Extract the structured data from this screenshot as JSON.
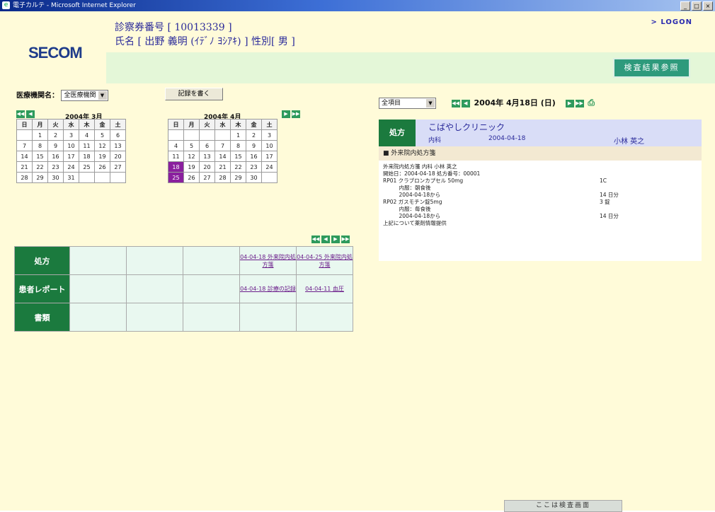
{
  "window": {
    "title": "電子カルテ - Microsoft Internet Explorer",
    "buttons": [
      "_",
      "□",
      "×"
    ]
  },
  "header": {
    "logo": "SECOM",
    "card_no_line": "診察券番号 [ 10013339 ]",
    "name_line": "氏名 [ 出野 義明 (ｲﾃﾞﾉ ﾖｼｱｷ) ] 性別[ 男 ]",
    "logon": "> LOGON",
    "menu_button": "検査結果参照"
  },
  "left": {
    "facility_label": "医療機関名：",
    "facility_value": "全医療機関",
    "record_button": "記録を書く",
    "nav_prev2": "◀◀",
    "nav_prev": "◀",
    "nav_next": "▶",
    "nav_next2": "▶▶",
    "calendars": [
      {
        "title": "2004年 3月",
        "dow": [
          "日",
          "月",
          "火",
          "水",
          "木",
          "金",
          "土"
        ],
        "weeks": [
          [
            "",
            "1",
            "2",
            "3",
            "4",
            "5",
            "6"
          ],
          [
            "7",
            "8",
            "9",
            "10",
            "11",
            "12",
            "13"
          ],
          [
            "14",
            "15",
            "16",
            "17",
            "18",
            "19",
            "20"
          ],
          [
            "21",
            "22",
            "23",
            "24",
            "25",
            "26",
            "27"
          ],
          [
            "28",
            "29",
            "30",
            "31",
            "",
            "",
            ""
          ]
        ]
      },
      {
        "title": "2004年 4月",
        "dow": [
          "日",
          "月",
          "火",
          "水",
          "木",
          "金",
          "土"
        ],
        "weeks": [
          [
            "",
            "",
            "",
            "",
            "1",
            "2",
            "3"
          ],
          [
            "4",
            "5",
            "6",
            "7",
            "8",
            "9",
            "10"
          ],
          [
            "11",
            "12",
            "13",
            "14",
            "15",
            "16",
            "17"
          ],
          [
            "18",
            "19",
            "20",
            "21",
            "22",
            "23",
            "24"
          ],
          [
            "25",
            "26",
            "27",
            "28",
            "29",
            "30",
            ""
          ]
        ],
        "highlighted": [
          "18",
          "25"
        ]
      }
    ],
    "grid": {
      "rows": [
        {
          "label": "処方",
          "cells": [
            "",
            "",
            "",
            "04-04-18 外来院内処方箋",
            "04-04-25 外来院内処方箋"
          ]
        },
        {
          "label": "患者レポート",
          "cells": [
            "",
            "",
            "",
            "04-04-18 診療の記録",
            "04-04-11 血圧"
          ]
        },
        {
          "label": "書類",
          "cells": [
            "",
            "",
            "",
            "",
            ""
          ]
        }
      ]
    }
  },
  "right": {
    "filter_value": "全項目",
    "current_date": "2004年 4月18日 (日)",
    "record": {
      "tag": "処方",
      "clinic": "こばやしクリニック",
      "dept": "内科",
      "date": "2004-04-18",
      "doctor": "小林 英之",
      "section": "■ 外来院内処方箋",
      "lines": [
        {
          "t": "外来院内処方箋 内科 小林 英之",
          "r": ""
        },
        {
          "t": "開始日：2004-04-18 処方番号：00001",
          "r": ""
        },
        {
          "t": "RP01 クラブロンカプセル 50mg",
          "r": "1C"
        },
        {
          "t": "　　　内服：朝食後",
          "r": ""
        },
        {
          "t": "　　　2004-04-18から",
          "r": "14 日分"
        },
        {
          "t": "RP02 ガスモチン錠5mg",
          "r": "3 錠"
        },
        {
          "t": "　　　内服：毎食後",
          "r": ""
        },
        {
          "t": "　　　2004-04-18から",
          "r": "14 日分"
        },
        {
          "t": "上記について薬剤情報提供",
          "r": ""
        }
      ]
    }
  },
  "footer": {
    "tab": "ここは検査画面"
  }
}
